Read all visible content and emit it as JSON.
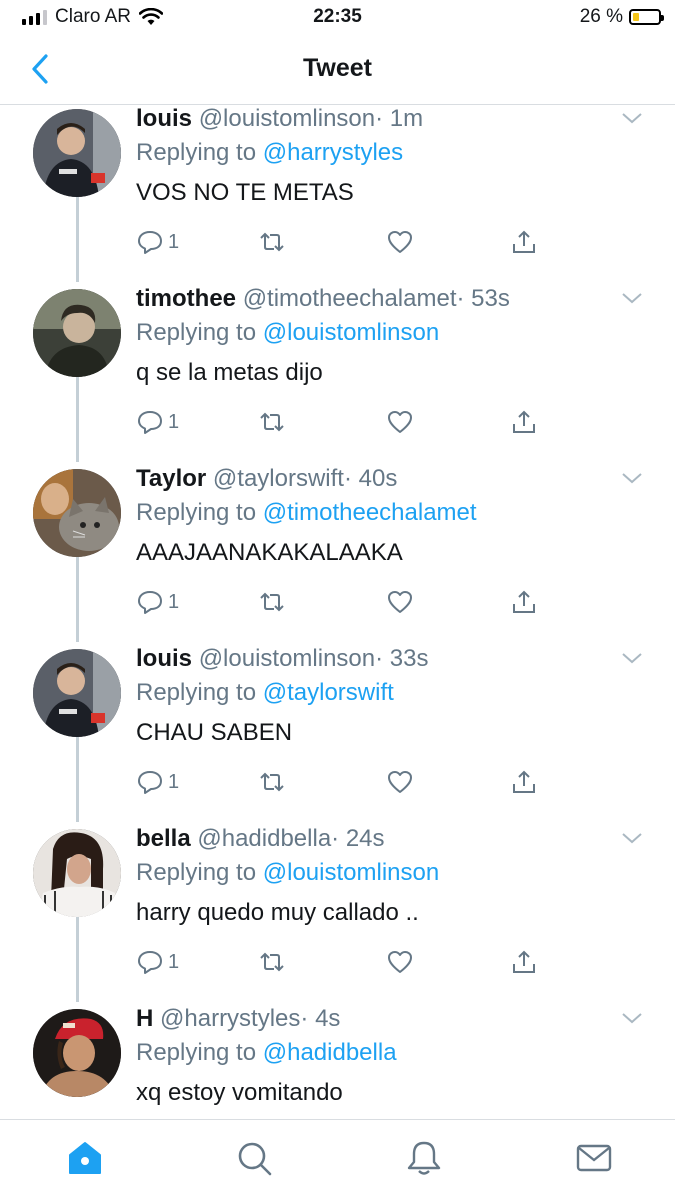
{
  "status_bar": {
    "carrier": "Claro AR",
    "time": "22:35",
    "battery_percent": "26 %",
    "battery_level": 0.26,
    "signal_bars": 3
  },
  "nav": {
    "title": "Tweet",
    "back_icon": "chevron-left-icon"
  },
  "colors": {
    "accent": "#1da1f2",
    "secondary_text": "#657786",
    "thread_line": "#c4cfd6"
  },
  "tweets": [
    {
      "name": "louis",
      "handle": "@louistomlinson",
      "time": "· 1m",
      "replying_label": "Replying to",
      "replying_to": "@harrystyles",
      "text": "VOS NO TE METAS",
      "reply_count": "1"
    },
    {
      "name": "timothee",
      "handle": "@timotheechalamet",
      "time": "· 53s",
      "replying_label": "Replying to",
      "replying_to": "@louistomlinson",
      "text": "q se la metas dijo",
      "reply_count": "1"
    },
    {
      "name": "Taylor",
      "handle": "@taylorswift",
      "time": "· 40s",
      "replying_label": "Replying to",
      "replying_to": "@timotheechalamet",
      "text": "AAAJAANAKAKALAAKA",
      "reply_count": "1"
    },
    {
      "name": "louis",
      "handle": "@louistomlinson",
      "time": "· 33s",
      "replying_label": "Replying to",
      "replying_to": "@taylorswift",
      "text": "CHAU SABEN",
      "reply_count": "1"
    },
    {
      "name": "bella",
      "handle": "@hadidbella",
      "time": "· 24s",
      "replying_label": "Replying to",
      "replying_to": "@louistomlinson",
      "text": "harry quedo muy callado ..",
      "reply_count": "1"
    },
    {
      "name": "H",
      "handle": "@harrystyles",
      "time": "· 4s",
      "replying_label": "Replying to",
      "replying_to": "@hadidbella",
      "text": "xq estoy vomitando",
      "reply_count": ""
    }
  ],
  "tab_bar": {
    "items": [
      "home-icon",
      "search-icon",
      "notifications-icon",
      "messages-icon"
    ],
    "active": "home-icon"
  }
}
